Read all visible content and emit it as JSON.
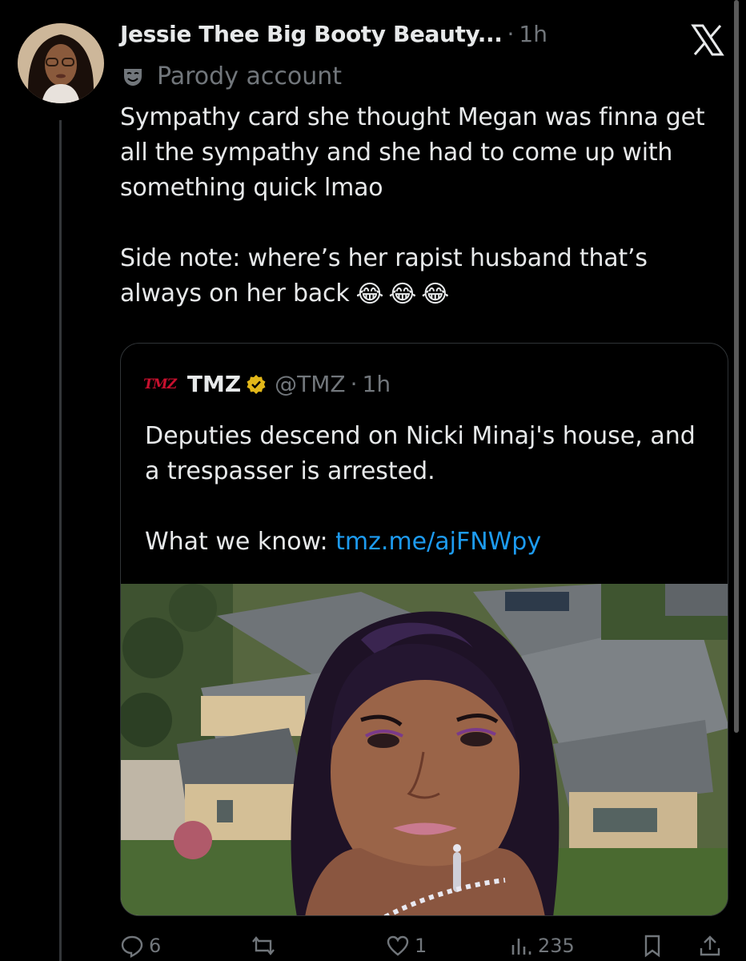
{
  "tweet": {
    "display_name": "Jessie Thee Big Booty Beauty...",
    "separator": "·",
    "time": "1h",
    "parody_label": "Parody account",
    "body_line1": "Sympathy card she thought Megan was finna get all the sympathy and she had to come up with something quick lmao",
    "body_line2": "Side note: where’s her rapist husband that’s always on her back",
    "emojis": [
      "😂",
      "😂",
      "😂"
    ]
  },
  "quote": {
    "logo_text": "TMZ",
    "name": "TMZ",
    "handle": "@TMZ",
    "separator": "·",
    "time": "1h",
    "text": "Deputies descend on Nicki Minaj's house, and a trespasser is arrested.",
    "link_prefix": "What we know: ",
    "link": "tmz.me/ajFNWpy"
  },
  "actions": {
    "replies": "6",
    "reposts": "",
    "likes": "1",
    "views": "235"
  },
  "colors": {
    "background": "#000000",
    "text": "#e7e9ea",
    "muted": "#71767b",
    "link": "#1d9bf0",
    "border": "#2f3336",
    "verified_gold": "#e2b719"
  },
  "icons": [
    "x-logo-icon",
    "parody-mask-icon",
    "verified-badge-icon",
    "reply-icon",
    "repost-icon",
    "like-icon",
    "views-icon",
    "bookmark-icon",
    "share-icon"
  ]
}
